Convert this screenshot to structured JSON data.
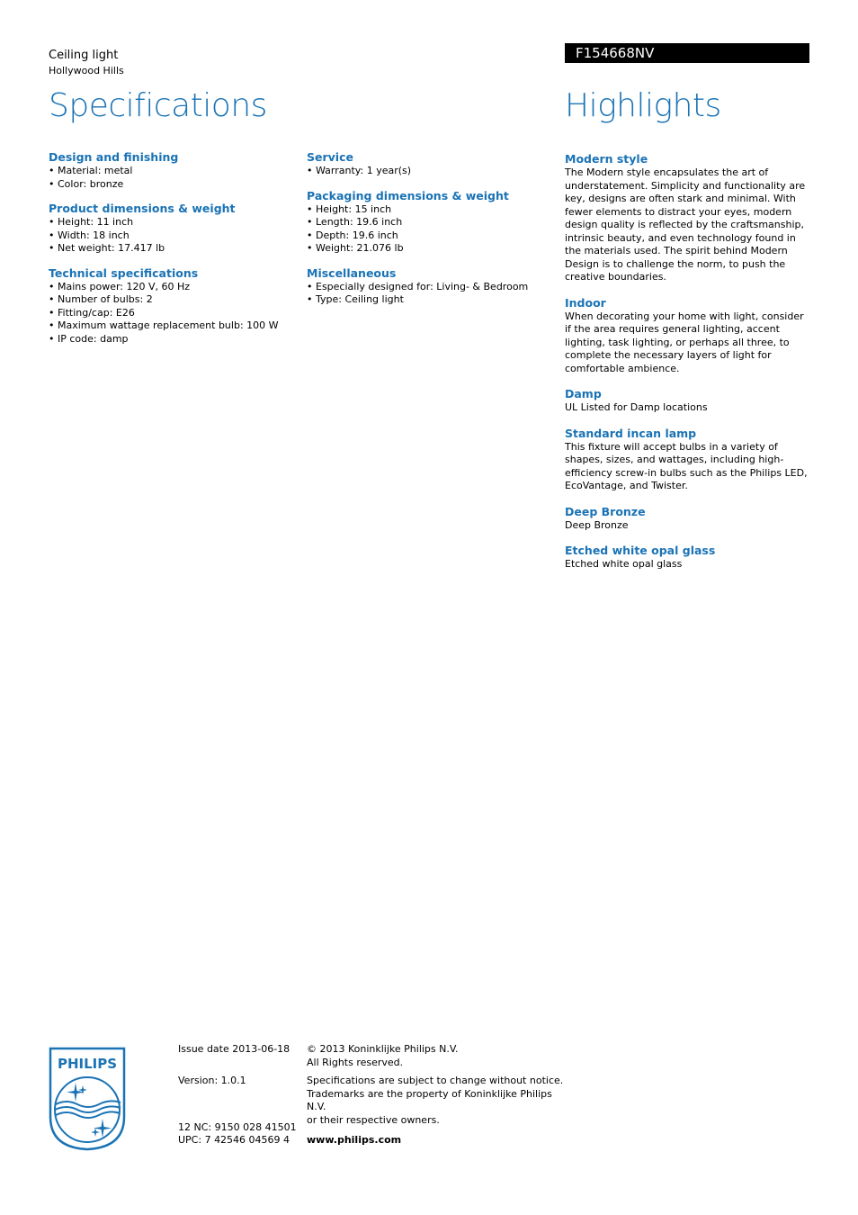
{
  "header": {
    "product_type": "Ceiling light",
    "product_name": "Hollywood Hills",
    "model_number": "F154668NV",
    "specifications_title": "Specifications",
    "highlights_title": "Highlights"
  },
  "colors": {
    "accent": "#1a73b5",
    "model_bar_bg": "#000000",
    "model_bar_text": "#ffffff"
  },
  "specifications": {
    "column1": [
      {
        "title": "Design and finishing",
        "items": [
          "Material: metal",
          "Color: bronze"
        ]
      },
      {
        "title": "Product dimensions & weight",
        "items": [
          "Height: 11 inch",
          "Width: 18 inch",
          "Net weight: 17.417 lb"
        ]
      },
      {
        "title": "Technical specifications",
        "items": [
          "Mains power: 120 V, 60 Hz",
          "Number of bulbs: 2",
          "Fitting/cap: E26",
          "Maximum wattage replacement bulb: 100 W",
          "IP code: damp"
        ]
      }
    ],
    "column2": [
      {
        "title": "Service",
        "items": [
          "Warranty: 1 year(s)"
        ]
      },
      {
        "title": "Packaging dimensions & weight",
        "items": [
          "Height: 15 inch",
          "Length: 19.6 inch",
          "Depth: 19.6 inch",
          "Weight: 21.076 lb"
        ]
      },
      {
        "title": "Miscellaneous",
        "items": [
          "Especially designed for: Living- & Bedroom",
          "Type: Ceiling light"
        ]
      }
    ]
  },
  "highlights": [
    {
      "title": "Modern style",
      "text": "The Modern style encapsulates the art of understatement. Simplicity and functionality are key, designs are often stark and minimal. With fewer elements to distract your eyes, modern design quality is reflected by the craftsmanship, intrinsic beauty, and even technology found in the materials used. The spirit behind Modern Design is to challenge the norm, to push the creative boundaries."
    },
    {
      "title": "Indoor",
      "text": "When decorating your home with light, consider if the area requires general lighting, accent lighting, task lighting, or perhaps all three, to complete the necessary layers of light for comfortable ambience."
    },
    {
      "title": "Damp",
      "text": "UL Listed for Damp locations"
    },
    {
      "title": "Standard incan lamp",
      "text": "This fixture will accept bulbs in a variety of shapes, sizes, and wattages, including high-efficiency screw-in bulbs such as the Philips LED, EcoVantage, and Twister."
    },
    {
      "title": "Deep Bronze",
      "text": "Deep Bronze"
    },
    {
      "title": "Etched white opal glass",
      "text": "Etched white opal glass"
    }
  ],
  "footer": {
    "logo_text": "PHILIPS",
    "issue_date": "Issue date 2013-06-18",
    "version": "Version: 1.0.1",
    "nc": "12 NC: 9150 028 41501",
    "upc": "UPC: 7 42546 04569 4",
    "copyright_line1": "© 2013 Koninklijke Philips N.V.",
    "copyright_line2": "All Rights reserved.",
    "legal_line1": "Specifications are subject to change without notice.",
    "legal_line2": "Trademarks are the property of Koninklijke Philips N.V.",
    "legal_line3": "or their respective owners.",
    "website": "www.philips.com"
  }
}
